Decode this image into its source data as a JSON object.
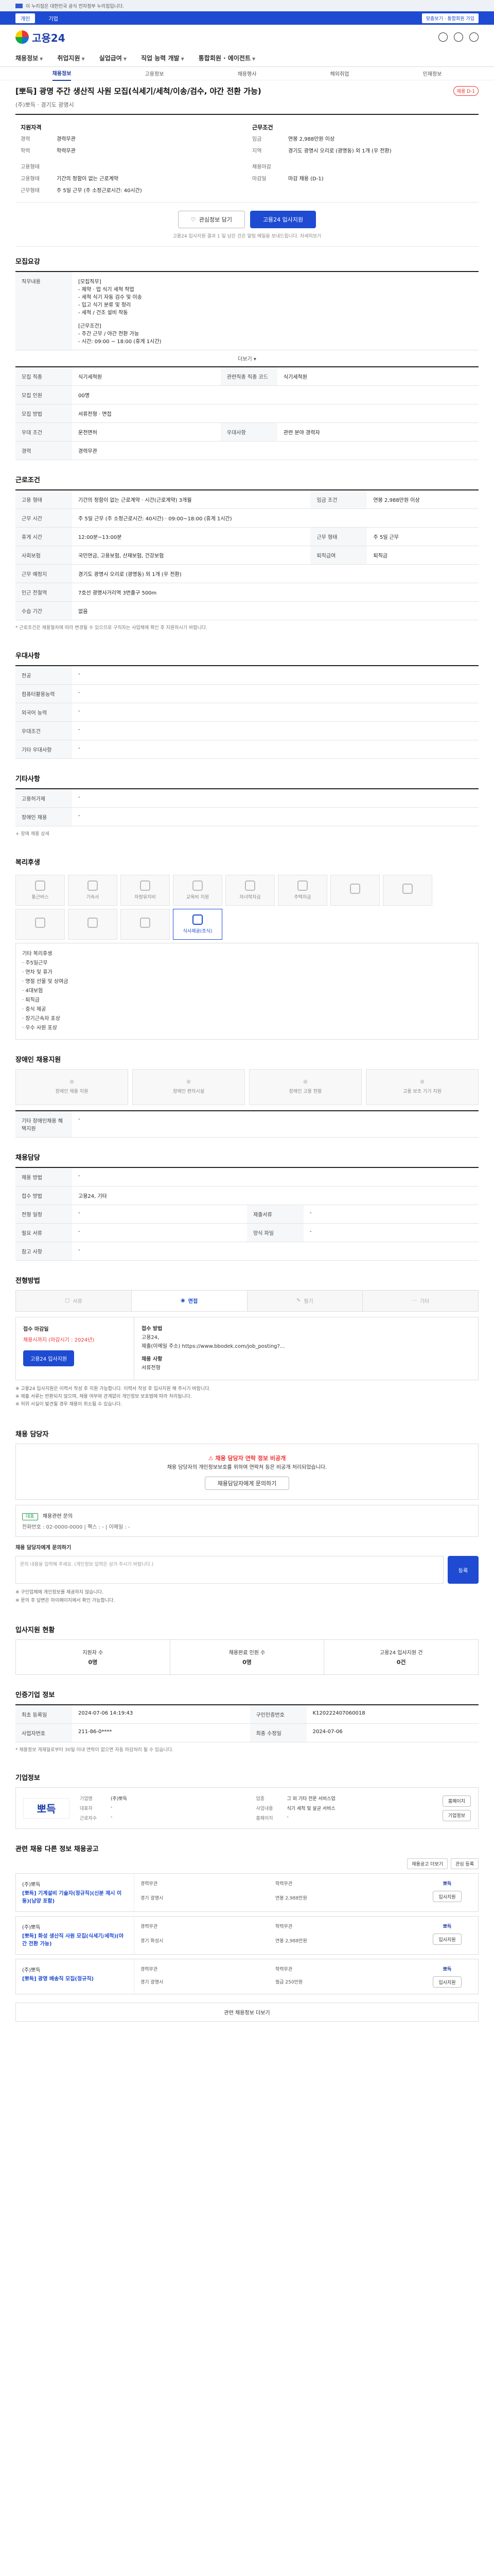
{
  "govbar": {
    "text": "이 누리집은 대한민국 공식 전자정부 누리집입니다."
  },
  "topstrip": {
    "tabs": [
      "개인",
      "기업"
    ],
    "right": "맞춤보기 · 통합회원 가입"
  },
  "brand": {
    "name": "고용24"
  },
  "gnb": [
    "채용정보",
    "취업지원",
    "실업급여",
    "직업 능력 개발",
    "통합회원 · 에이전트"
  ],
  "subnav": [
    "채용정보",
    "고용정보",
    "채용행사",
    "해외취업",
    "인재정보"
  ],
  "job": {
    "title": "[뽀득] 광명 주간 생산직 사원 모집(식세기/세척/이송/검수, 야간 전환 가능)",
    "badge": "채용 D-1",
    "company_line": "(주)뽀득 · 경기도 광명시",
    "summary_left_title": "지원자격",
    "summary_left": [
      {
        "k": "경력",
        "v": "경력무관"
      },
      {
        "k": "학력",
        "v": "학력무관"
      },
      {
        "k": "",
        "v": ""
      },
      {
        "k": "고용형태",
        "v": ""
      },
      {
        "k": "고용형태",
        "v": "기간의 정함이 없는 근로계약"
      },
      {
        "k": "근무형태",
        "v": "주 5일 근무 (주 소정근로시간: 40시간)"
      }
    ],
    "summary_right_title": "근무조건",
    "summary_right": [
      {
        "k": "임금",
        "v": "연봉 2,988만원 이상"
      },
      {
        "k": "지역",
        "v": "경기도 광명시 오리로 (광명동) 외 1개 (우 전환)"
      },
      {
        "k": "",
        "v": ""
      },
      {
        "k": "채용마감",
        "v": ""
      },
      {
        "k": "마감일",
        "v": "마감 채용 (D-1)"
      }
    ],
    "btn_scrap": "관심정보 담기",
    "btn_apply": "고용24 입사지원",
    "apply_note": "고용24 입사지원 결과 1 일 남은 건은 알림 메일을 보내드립니다. 자세히보기"
  },
  "sections": {
    "recruit": {
      "title": "모집요강",
      "duty_label": "직무내용",
      "duty_text": [
        "[모집직무]",
        "- 제약 · 업 식기 세척 작업",
        "- 세척 식기 자동 검수 및 이송",
        "- 입고 식기 분류 및 정리",
        "- 세척 / 건조 설비 작동",
        "",
        "[근무조건]",
        "- 주간 근무 / 야간 전환 가능",
        "- 시간: 09:00 ~ 18:00 (휴게 1시간)"
      ],
      "more": "더보기 ▾",
      "rows": [
        {
          "k": "모집 직종",
          "v": "식기세척원",
          "k2": "관련직종 직종 코드",
          "v2": "식기세척원"
        },
        {
          "k": "모집 인원",
          "v": "00명",
          "k2": "",
          "v2": ""
        },
        {
          "k": "모집 방법",
          "v": "서류전형 · 면접",
          "k2": "",
          "v2": ""
        },
        {
          "k": "우대 조건",
          "v": "운전면허",
          "k2": "우대사항",
          "v2": "관련 분야 경력자"
        },
        {
          "k": "경력",
          "v": "경력무관",
          "k2": "",
          "v2": ""
        }
      ]
    },
    "conditions": {
      "title": "근로조건",
      "rows": [
        {
          "k": "고용 형태",
          "v": "기간의 정함이 없는 근로계약 · 시간(근로계약) 3개월",
          "k2": "임금 조건",
          "v2": "연봉 2,988만원 이상"
        },
        {
          "k": "근무 시간",
          "v": "주 5일 근무 (주 소정근로시간: 40시간) · 09:00~18:00 (휴게 1시간)",
          "k2": "",
          "v2": ""
        },
        {
          "k": "휴게 시간",
          "v": "12:00분~13:00분",
          "k2": "근무 형태",
          "v2": "주 5일 근무"
        },
        {
          "k": "사회보험",
          "v": "국민연금, 고용보험, 산재보험, 건강보험",
          "k2": "퇴직급여",
          "v2": "퇴직금"
        },
        {
          "k": "근무 예정지",
          "v": "경기도 광명시 오리로 (광명동) 외 1개 (우 전환)",
          "k2": "",
          "v2": ""
        },
        {
          "k": "인근 전철역",
          "v": "7호선 광명사거리역 3번출구 500m",
          "k2": "",
          "v2": ""
        },
        {
          "k": "수습 기간",
          "v": "없음",
          "k2": "",
          "v2": ""
        }
      ],
      "map_btn": "지도 보기",
      "footnote": "* 근로조건은 채용절차에 따라 변경될 수 있으므로 구직자는 사업체에 확인 후 지원하시기 바랍니다."
    },
    "benefits": {
      "title": "우대사항",
      "rows": [
        {
          "k": "전공",
          "v": "-"
        },
        {
          "k": "컴퓨터활용능력",
          "v": "-"
        },
        {
          "k": "외국어 능력",
          "v": "-"
        },
        {
          "k": "우대조건",
          "v": "-"
        },
        {
          "k": "기타 우대사항",
          "v": "-"
        }
      ]
    },
    "other": {
      "title": "기타사항",
      "rows": [
        {
          "k": "고용허가제",
          "v": "-"
        },
        {
          "k": "장애인 채용",
          "v": "-"
        }
      ],
      "link": "장애 채용 상세"
    },
    "welfare": {
      "title": "복리후생",
      "icons": [
        {
          "label": "통근버스",
          "on": false
        },
        {
          "label": "기숙사",
          "on": false
        },
        {
          "label": "차량유지비",
          "on": false
        },
        {
          "label": "교육비 지원",
          "on": false
        },
        {
          "label": "자녀학자금",
          "on": false
        },
        {
          "label": "주택자금",
          "on": false
        },
        {
          "label": "",
          "on": false
        },
        {
          "label": "",
          "on": false
        },
        {
          "label": "",
          "on": false
        },
        {
          "label": "",
          "on": false
        },
        {
          "label": "",
          "on": false
        },
        {
          "label": "식사제공(조식)",
          "on": true
        }
      ],
      "list": [
        "기타 복리후생",
        "· 주5일근무",
        "· 연차 및 휴가",
        "· 명절 선물 및 상여금",
        "· 4대보험",
        "· 퇴직금",
        "· 중식 제공",
        "· 장기근속자 포상",
        "· 우수 사원 포상"
      ]
    },
    "hiring": {
      "title": "장애인 채용지원",
      "cards": [
        "장애인 채용 지원",
        "장애인 편의시설",
        "장애인 고용 현황",
        "고용 보조 기기 지원"
      ],
      "row_label": "기타 장애인채용 혜택지원",
      "row_value": "-"
    },
    "manager": {
      "title": "채용담당",
      "rows": [
        {
          "k": "채용 방법",
          "v": "-",
          "k2": "",
          "v2": ""
        },
        {
          "k": "접수 방법",
          "v": "고용24, 기타",
          "k2": "",
          "v2": ""
        },
        {
          "k": "전형 일정",
          "v": "-",
          "k2": "제출서류",
          "v2": "-"
        },
        {
          "k": "필요 서류",
          "v": "-",
          "k2": "양식 파일",
          "v2": "-"
        },
        {
          "k": "참고 사항",
          "v": "-",
          "k2": "",
          "v2": ""
        }
      ]
    },
    "process": {
      "title": "전형방법",
      "steps": [
        "서류",
        "면접",
        "필기",
        "기타"
      ],
      "left_title": "접수 마감일",
      "left_value": "채용시까지 (마감시기 : 2024년)",
      "left_btn": "고용24 입사지원",
      "right_title": "접수 방법",
      "right_text": "고용24,\n제출(이메일 주소) https://www.bbodek.com/job_posting?...",
      "right_label": "채용 사항",
      "right_value": "서류전형",
      "bullets": [
        "※ 고용24 입사지원은 이력서 작성 후 지원 가능합니다. 이력서 작성 후 입사지원 해 주시기 바랍니다.",
        "※ 제출 서류는 반환되지 않으며, 채용 여부와 관계없이 개인정보 보호법에 따라 처리됩니다.",
        "※ 허위 사실이 발견될 경우 채용이 취소될 수 있습니다."
      ]
    },
    "contact": {
      "title": "채용 담당자",
      "alert_title": "채용 담당자 연락 정보 비공개",
      "alert_text": "채용 담당자의 개인정보보호를 위하여 연락처 등은 비공개 처리되었습니다.",
      "alert_btn": "채용담당자에게 문의하기",
      "sub_tag": "대표",
      "sub_text": "채용관련 문의",
      "sub_detail": "전화번호 : 02-0000-0000  |  팩스 : -  |  이메일 : -",
      "inquiry_title": "채용 담당자에게 문의하기",
      "inquiry_placeholder": "문의 내용을 입력해 주세요. (개인정보 입력은 삼가 주시기 바랍니다.)",
      "inquiry_btn": "등록",
      "notes": [
        "※ 구인업체에 개인정보를 제공하지 않습니다.",
        "※ 문의 후 답변은 마이페이지에서 확인 가능합니다."
      ]
    },
    "status": {
      "title": "입사지원 현황",
      "items": [
        {
          "label": "지원자 수",
          "value": "0명"
        },
        {
          "label": "채용완료 인원 수",
          "value": "0명"
        },
        {
          "label": "고용24 입사지원 건",
          "value": "0건"
        }
      ]
    },
    "privacy": {
      "title": "인증기업 정보",
      "rows": [
        {
          "k": "최초 등록일",
          "v": "2024-07-06 14:19:43",
          "k2": "구인인증번호",
          "v2": "K120222407060018"
        },
        {
          "k": "사업자번호",
          "v": "211-86-0****",
          "k2": "최종 수정일",
          "v2": "2024-07-06"
        }
      ],
      "footnote": "* 채용정보 게재일로부터 30일 이내 연락이 없으면 자동 마감처리 될 수 있습니다."
    },
    "company": {
      "title": "기업정보",
      "logo": "뽀득",
      "info": [
        {
          "k": "기업명",
          "v": "(주)뽀득"
        },
        {
          "k": "업종",
          "v": "그 외 기타 전문 서비스업"
        },
        {
          "k": "대표자",
          "v": "-"
        },
        {
          "k": "사업내용",
          "v": "식기 세척 및 살균 서비스"
        },
        {
          "k": "근로자수",
          "v": "-"
        },
        {
          "k": "홈페이지",
          "v": "-"
        }
      ],
      "btn1": "홈페이지",
      "btn2": "기업정보"
    },
    "similar": {
      "title": "관련 채용 다른 정보 채용공고",
      "actions": [
        "채용공고 더보기",
        "관심 등록"
      ],
      "items": [
        {
          "company": "(주)뽀득",
          "title": "[뽀득] 기계설비 기술자(정규직)(신분 제시 이동)(남양 포함)",
          "l1": "경력무관",
          "l2": "학력무관",
          "l3": "경기 광명시",
          "l4": "연봉 2,988만원",
          "logo": "뽀득",
          "btn": "입사지원"
        },
        {
          "company": "(주)뽀득",
          "title": "[뽀득] 화성 생산직 사원 모집(식세기/세척)(야간 전환 가능)",
          "l1": "경력무관",
          "l2": "학력무관",
          "l3": "경기 화성시",
          "l4": "연봉 2,988만원",
          "logo": "뽀득",
          "btn": "입사지원"
        },
        {
          "company": "(주)뽀득",
          "title": "[뽀득] 광명 배송직 모집(정규직)",
          "l1": "경력무관",
          "l2": "학력무관",
          "l3": "경기 광명시",
          "l4": "월급 250만원",
          "logo": "뽀득",
          "btn": "입사지원"
        }
      ],
      "more": "관련 채용정보 더보기"
    }
  }
}
